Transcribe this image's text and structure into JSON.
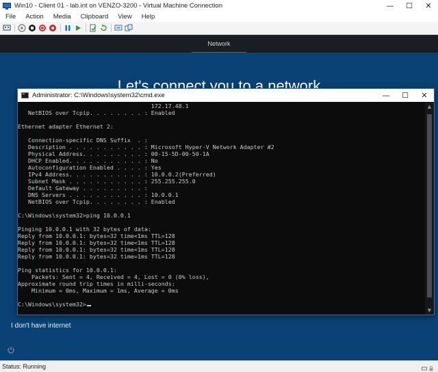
{
  "vm_window": {
    "title": "Win10 - Client 01 - lab.int on VENZO-3200 - Virtual Machine Connection",
    "controls": {
      "minimize": "—",
      "maximize": "☐",
      "close": "✕"
    },
    "menu": [
      "File",
      "Action",
      "Media",
      "Clipboard",
      "View",
      "Help"
    ],
    "toolbar_icons": [
      "ctrl-alt-del-icon",
      "start-icon",
      "turn-off-icon",
      "shut-down-icon",
      "save-icon",
      "pause-icon",
      "resume-icon",
      "checkpoint-icon",
      "revert-icon",
      "enhanced-session-icon",
      "share-icon"
    ]
  },
  "oobe": {
    "step": "Network",
    "heading": "Let's connect you to a network",
    "no_internet_link": "I don't have internet"
  },
  "cmd_window": {
    "title": "Administrator: C:\\Windows\\system32\\cmd.exe",
    "controls": {
      "minimize": "—",
      "maximize": "☐",
      "close": "✕"
    },
    "lines": [
      "                                       172.17.48.1",
      "   NetBIOS over Tcpip. . . . . . . . : Enabled",
      "",
      "Ethernet adapter Ethernet 2:",
      "",
      "   Connection-specific DNS Suffix  . :",
      "   Description . . . . . . . . . . . : Microsoft Hyper-V Network Adapter #2",
      "   Physical Address. . . . . . . . . : 00-15-5D-00-50-1A",
      "   DHCP Enabled. . . . . . . . . . . : No",
      "   Autoconfiguration Enabled . . . . : Yes",
      "   IPv4 Address. . . . . . . . . . . : 10.0.0.2(Preferred)",
      "   Subnet Mask . . . . . . . . . . . : 255.255.255.0",
      "   Default Gateway . . . . . . . . . :",
      "   DNS Servers . . . . . . . . . . . : 10.0.0.1",
      "   NetBIOS over Tcpip. . . . . . . . : Enabled",
      "",
      "C:\\Windows\\system32>ping 10.0.0.1",
      "",
      "Pinging 10.0.0.1 with 32 bytes of data:",
      "Reply from 10.0.0.1: bytes=32 time<1ms TTL=128",
      "Reply from 10.0.0.1: bytes=32 time<1ms TTL=128",
      "Reply from 10.0.0.1: bytes=32 time<1ms TTL=128",
      "Reply from 10.0.0.1: bytes=32 time=1ms TTL=128",
      "",
      "Ping statistics for 10.0.0.1:",
      "    Packets: Sent = 4, Received = 4, Lost = 0 (0% loss),",
      "Approximate round trip times in milli-seconds:",
      "    Minimum = 0ms, Maximum = 1ms, Average = 0ms",
      "",
      "C:\\Windows\\system32>"
    ]
  },
  "status_bar": {
    "text": "Status: Running"
  },
  "colors": {
    "oobe_background": "#0a4275",
    "console_background": "#0c0c0c",
    "console_text": "#cccccc"
  }
}
